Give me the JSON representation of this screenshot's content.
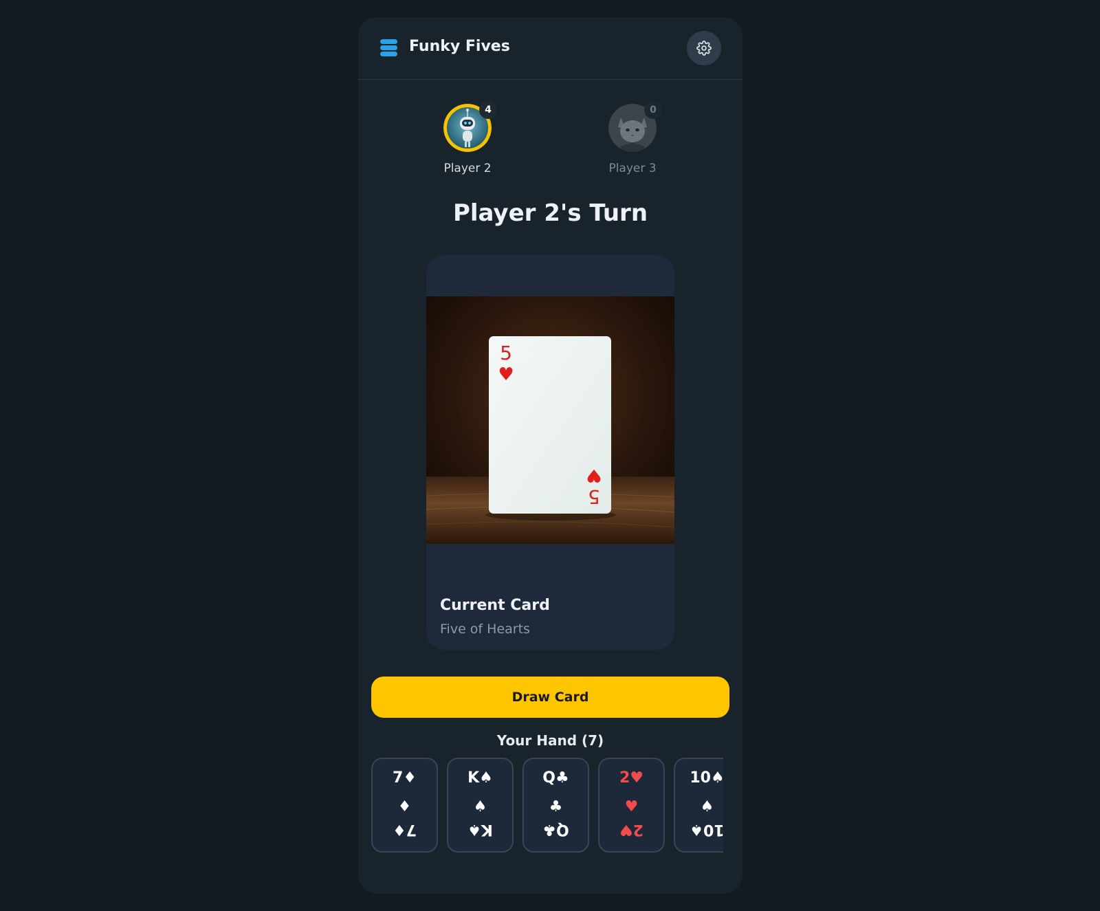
{
  "app": {
    "title": "Funky Fives",
    "logo_icon": "stack-icon",
    "settings_icon": "gear-icon"
  },
  "players": [
    {
      "name": "Player 2",
      "card_count": "4",
      "avatar": "robot-avatar",
      "active": true
    },
    {
      "name": "Player 3",
      "card_count": "0",
      "avatar": "cat-avatar",
      "active": false
    }
  ],
  "turn": {
    "title": "Player 2's Turn"
  },
  "current_card": {
    "label": "Current Card",
    "value": "Five of Hearts",
    "rank": "5",
    "suit_symbol": "♥"
  },
  "actions": {
    "draw_label": "Draw Card"
  },
  "hand": {
    "title": "Your Hand (7)",
    "cards": [
      {
        "label": "7♦",
        "suit": "♦",
        "color": "white"
      },
      {
        "label": "K♠",
        "suit": "♠",
        "color": "white"
      },
      {
        "label": "Q♣",
        "suit": "♣",
        "color": "white"
      },
      {
        "label": "2♥",
        "suit": "♥",
        "color": "red"
      },
      {
        "label": "10♠",
        "suit": "♠",
        "color": "white"
      }
    ]
  },
  "colors": {
    "accent": "#fec600",
    "background": "#121b21",
    "panel": "#18232c",
    "red_suit": "#f24b4b"
  }
}
